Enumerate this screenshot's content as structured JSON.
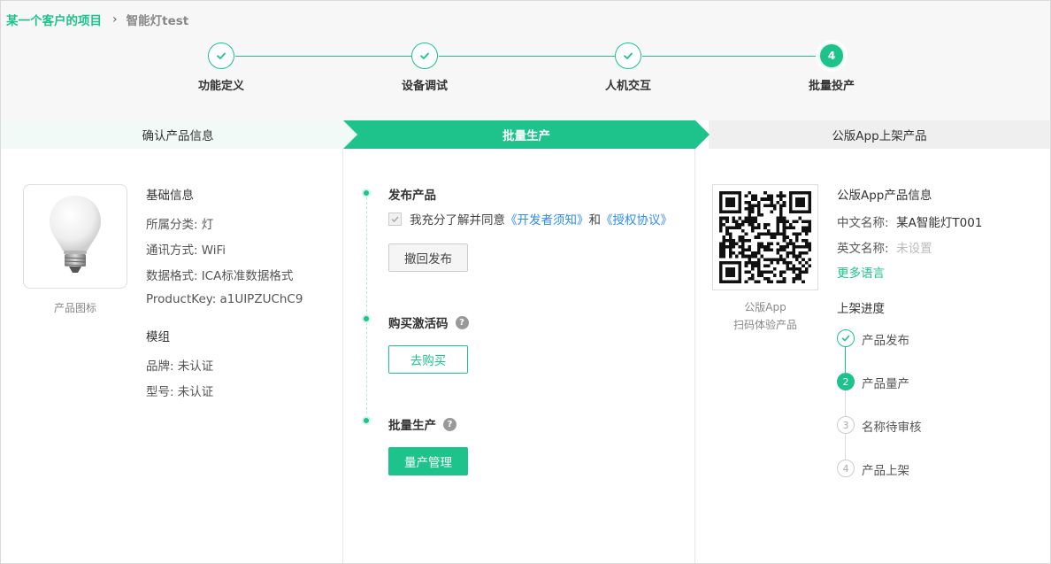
{
  "breadcrumb": {
    "project": "某一个客户的项目",
    "product": "智能灯test"
  },
  "steps": [
    {
      "label": "功能定义",
      "state": "done"
    },
    {
      "label": "设备调试",
      "state": "done"
    },
    {
      "label": "人机交互",
      "state": "done"
    },
    {
      "label": "批量投产",
      "state": "current",
      "number": "4"
    }
  ],
  "tabs": [
    "确认产品信息",
    "批量生产",
    "公版App上架产品"
  ],
  "product": {
    "icon_caption": "产品图标",
    "basic_title": "基础信息",
    "category_label": "所属分类:",
    "category_value": "灯",
    "comm_label": "通讯方式:",
    "comm_value": "WiFi",
    "format_label": "数据格式:",
    "format_value": "ICA标准数据格式",
    "key_label": "ProductKey:",
    "key_value": "a1UIPZUChC9",
    "module_title": "模组",
    "brand_label": "品牌:",
    "brand_value": "未认证",
    "model_label": "型号:",
    "model_value": "未认证"
  },
  "mass": {
    "publish_title": "发布产品",
    "agree_text": "我充分了解并同意",
    "dev_notice": "《开发者须知》",
    "and": "和",
    "auth_agreement": "《授权协议》",
    "revoke_button": "撤回发布",
    "buy_title": "购买激活码",
    "buy_button": "去购买",
    "mass_title": "批量生产",
    "manage_button": "量产管理",
    "help_glyph": "?"
  },
  "app": {
    "qr_caption_1": "公版App",
    "qr_caption_2": "扫码体验产品",
    "info_title": "公版App产品信息",
    "cn_label": "中文名称:",
    "cn_value": "某A智能灯T001",
    "en_label": "英文名称:",
    "en_value": "未设置",
    "more_lang": "更多语言",
    "progress_title": "上架进度",
    "progress": [
      {
        "label": "产品发布",
        "state": "done",
        "number": ""
      },
      {
        "label": "产品量产",
        "state": "current",
        "number": "2"
      },
      {
        "label": "名称待审核",
        "state": "todo",
        "number": "3"
      },
      {
        "label": "产品上架",
        "state": "todo",
        "number": "4"
      }
    ]
  },
  "colors": {
    "accent": "#1ec28b",
    "link": "#2d8cf0"
  }
}
